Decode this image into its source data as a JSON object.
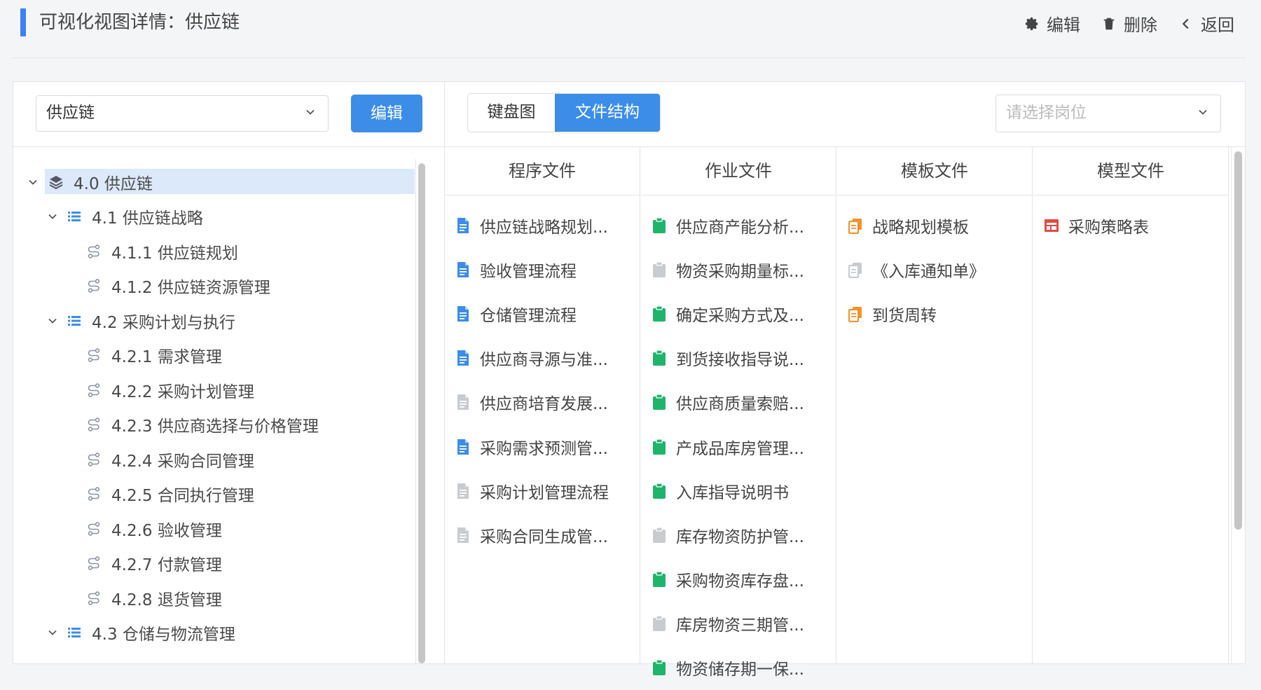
{
  "header": {
    "title": "可视化视图详情：供应链",
    "actions": [
      {
        "label": "编辑",
        "icon": "gear-icon"
      },
      {
        "label": "删除",
        "icon": "trash-icon"
      },
      {
        "label": "返回",
        "icon": "chevron-left-icon"
      }
    ]
  },
  "left": {
    "select_value": "供应链",
    "edit_button": "编辑",
    "tree": [
      {
        "label": "4.0 供应链",
        "level": 0,
        "icon": "layers-icon",
        "expanded": true,
        "selected": true
      },
      {
        "label": "4.1 供应链战略",
        "level": 1,
        "icon": "list-icon",
        "expanded": true
      },
      {
        "label": "4.1.1 供应链规划",
        "level": 2,
        "icon": "process-icon"
      },
      {
        "label": "4.1.2 供应链资源管理",
        "level": 2,
        "icon": "process-icon"
      },
      {
        "label": "4.2 采购计划与执行",
        "level": 1,
        "icon": "list-icon",
        "expanded": true
      },
      {
        "label": "4.2.1 需求管理",
        "level": 2,
        "icon": "process-icon"
      },
      {
        "label": "4.2.2 采购计划管理",
        "level": 2,
        "icon": "process-icon"
      },
      {
        "label": "4.2.3 供应商选择与价格管理",
        "level": 2,
        "icon": "process-icon"
      },
      {
        "label": "4.2.4 采购合同管理",
        "level": 2,
        "icon": "process-icon"
      },
      {
        "label": "4.2.5 合同执行管理",
        "level": 2,
        "icon": "process-icon"
      },
      {
        "label": "4.2.6 验收管理",
        "level": 2,
        "icon": "process-icon"
      },
      {
        "label": "4.2.7 付款管理",
        "level": 2,
        "icon": "process-icon"
      },
      {
        "label": "4.2.8 退货管理",
        "level": 2,
        "icon": "process-icon"
      },
      {
        "label": "4.3 仓储与物流管理",
        "level": 1,
        "icon": "list-icon",
        "expanded": true
      }
    ]
  },
  "right": {
    "segments": [
      "键盘图",
      "文件结构"
    ],
    "active_segment": "文件结构",
    "role_placeholder": "请选择岗位",
    "columns": [
      {
        "title": "程序文件",
        "files": [
          {
            "label": "供应链战略规划...",
            "icon": "doc-blue-icon"
          },
          {
            "label": "验收管理流程",
            "icon": "doc-blue-icon"
          },
          {
            "label": "仓储管理流程",
            "icon": "doc-blue-icon"
          },
          {
            "label": "供应商寻源与准...",
            "icon": "doc-blue-icon"
          },
          {
            "label": "供应商培育发展...",
            "icon": "doc-gray-icon"
          },
          {
            "label": "采购需求预测管...",
            "icon": "doc-blue-icon"
          },
          {
            "label": "采购计划管理流程",
            "icon": "doc-gray-icon"
          },
          {
            "label": "采购合同生成管...",
            "icon": "doc-gray-icon"
          }
        ]
      },
      {
        "title": "作业文件",
        "files": [
          {
            "label": "供应商产能分析...",
            "icon": "clipboard-green-icon"
          },
          {
            "label": "物资采购期量标...",
            "icon": "clipboard-gray-icon"
          },
          {
            "label": "确定采购方式及...",
            "icon": "clipboard-green-icon"
          },
          {
            "label": "到货接收指导说...",
            "icon": "clipboard-green-icon"
          },
          {
            "label": "供应商质量索赔...",
            "icon": "clipboard-green-icon"
          },
          {
            "label": "产成品库房管理...",
            "icon": "clipboard-green-icon"
          },
          {
            "label": "入库指导说明书",
            "icon": "clipboard-green-icon"
          },
          {
            "label": "库存物资防护管...",
            "icon": "clipboard-gray-icon"
          },
          {
            "label": "采购物资库存盘...",
            "icon": "clipboard-green-icon"
          },
          {
            "label": "库房物资三期管...",
            "icon": "clipboard-gray-icon"
          },
          {
            "label": "物资储存期一保...",
            "icon": "clipboard-green-icon"
          }
        ]
      },
      {
        "title": "模板文件",
        "files": [
          {
            "label": "战略规划模板",
            "icon": "copy-orange-icon"
          },
          {
            "label": "《入库通知单》",
            "icon": "copy-gray-icon"
          },
          {
            "label": "到货周转",
            "icon": "copy-orange-icon"
          }
        ]
      },
      {
        "title": "模型文件",
        "files": [
          {
            "label": "采购策略表",
            "icon": "table-red-icon"
          }
        ]
      }
    ]
  },
  "colors": {
    "primary": "#3b8de8",
    "accent_bar": "#3b82f6",
    "doc_blue": "#3b8de8",
    "clipboard_green": "#1fb46c",
    "copy_orange": "#f0932b",
    "table_red": "#e5483f",
    "inactive_gray": "#c8cbd0",
    "selected_bg": "#dce9fa"
  }
}
